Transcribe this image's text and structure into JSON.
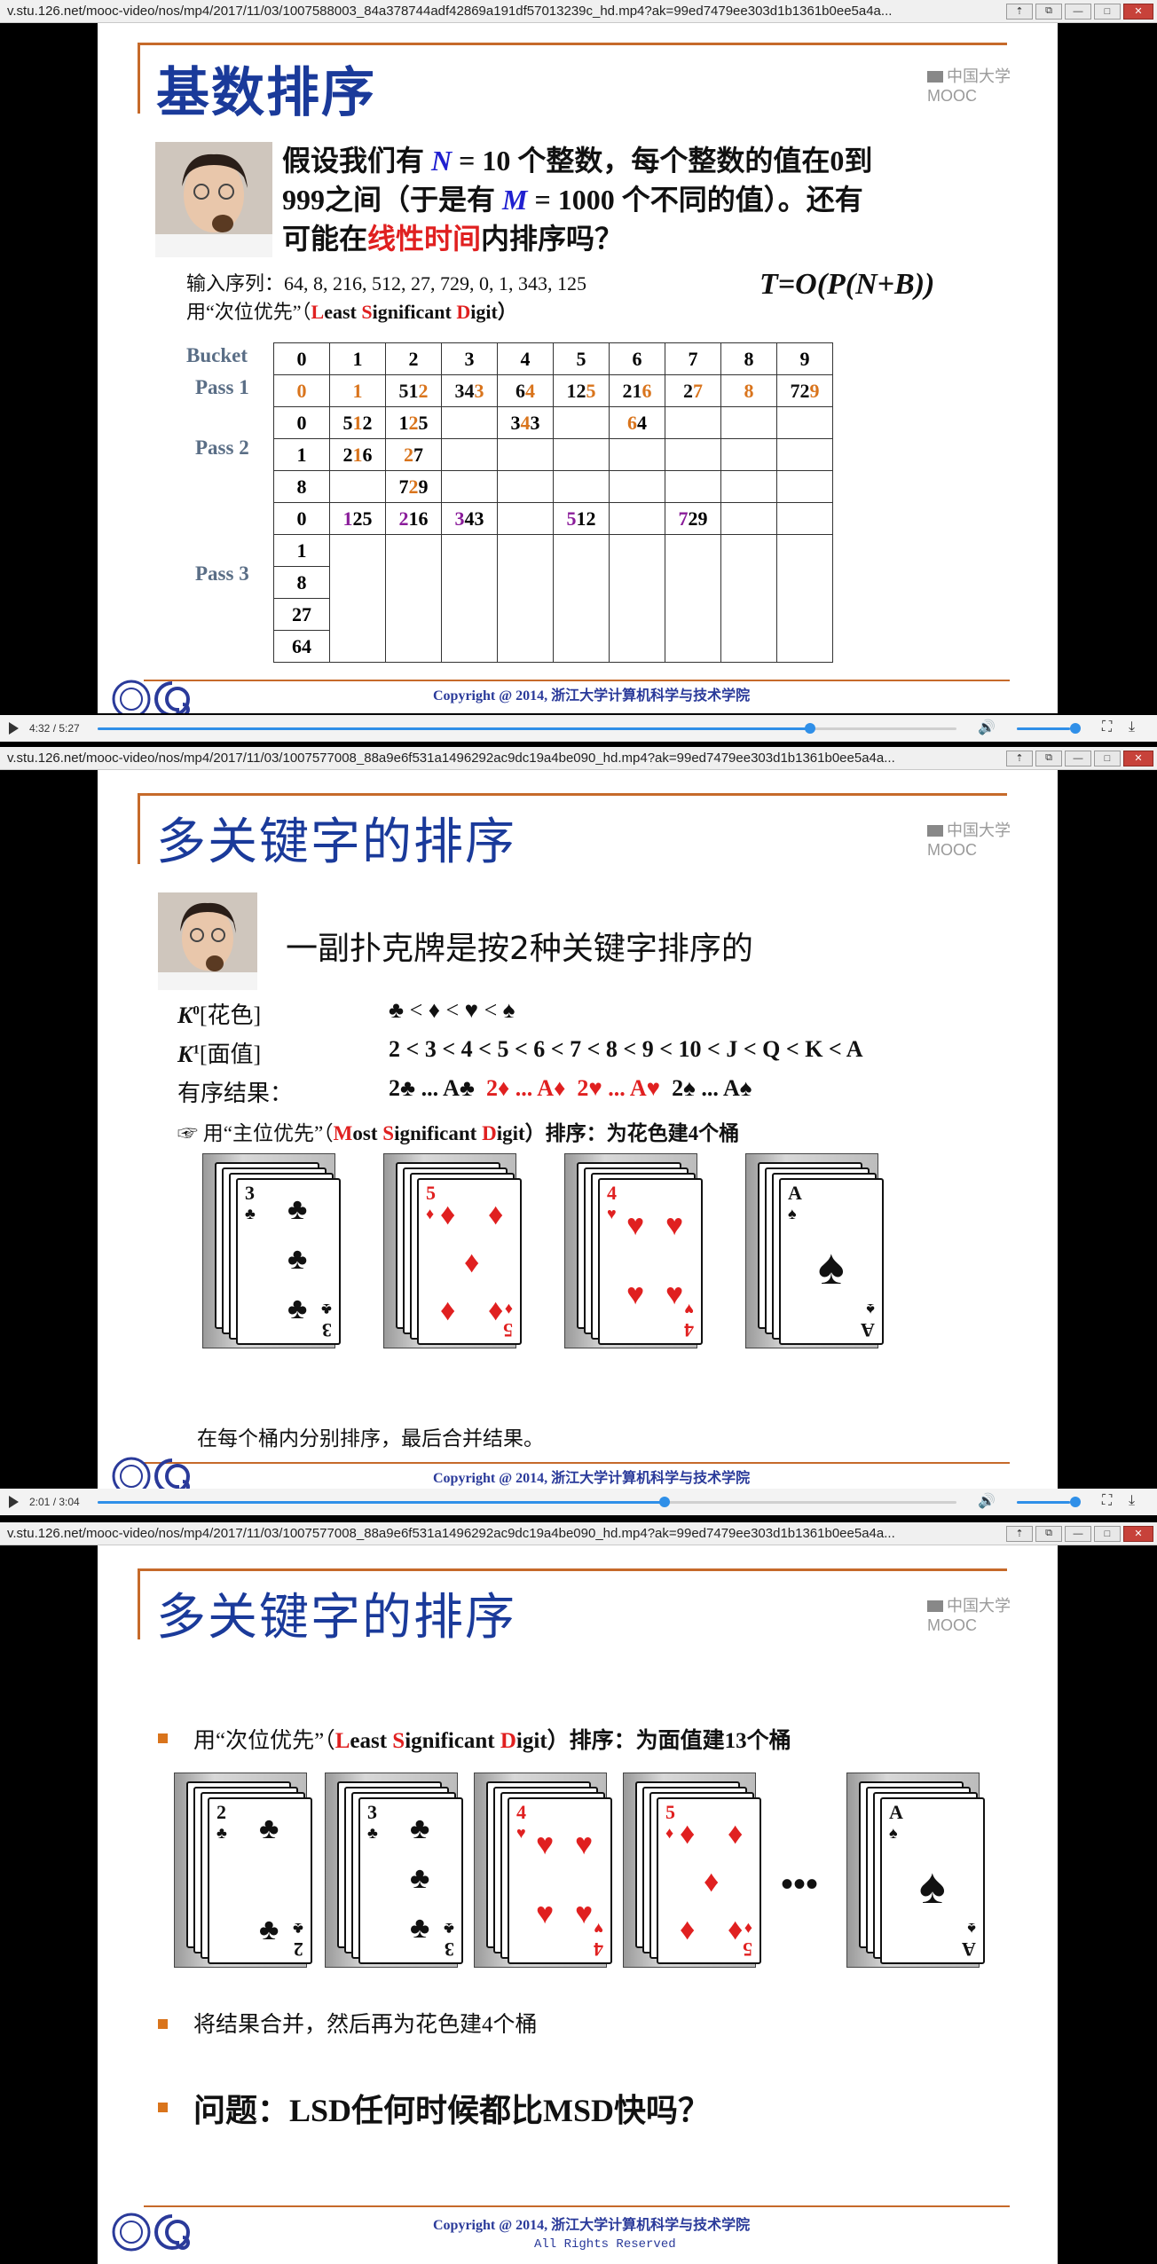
{
  "windows": [
    {
      "url": "v.stu.126.net/mooc-video/nos/mp4/2017/11/03/1007588003_84a378744adf42869a191df57013239c_hd.mp4?ak=99ed7479ee303d1b1361b0ee5a4a...",
      "time": "4:32 / 5:27",
      "progress": 0.83
    },
    {
      "url": "v.stu.126.net/mooc-video/nos/mp4/2017/11/03/1007577008_88a9e6f531a1496292ac9dc19a4be090_hd.mp4?ak=99ed7479ee303d1b1361b0ee5a4a...",
      "time": "2:01 / 3:04",
      "progress": 0.66
    },
    {
      "url": "v.stu.126.net/mooc-video/nos/mp4/2017/11/03/1007577008_88a9e6f531a1496292ac9dc19a4be090_hd.mp4?ak=99ed7479ee303d1b1361b0ee5a4a..."
    }
  ],
  "common": {
    "mooc": "中国大学MOOC",
    "copyright": "Copyright @ 2014, 浙江大学计算机科学与技术学院",
    "rights": "All Rights Reserved"
  },
  "slide1": {
    "title": "基数排序",
    "q1a": "假设我们有",
    "q1n": "N",
    "q1b": "= 10 个整数，每个整数的值在0到",
    "q2a": "999之间（于是有",
    "q2m": "M",
    "q2b": "= 1000 个不同的值）。还有",
    "q3a": "可能在",
    "q3red": "线性时间",
    "q3b": "内排序吗？",
    "input": "输入序列：64, 8, 216, 512, 27, 729, 0, 1, 343, 125",
    "lsd_a": "用“次位优先”（",
    "lsd_L": "L",
    "lsd_east": "east ",
    "lsd_S": "S",
    "lsd_ignificant": "ignificant ",
    "lsd_D": "D",
    "lsd_igit": "igit）",
    "formula": "T=O(P(N+B))",
    "labels": {
      "bucket": "Bucket",
      "pass1": "Pass 1",
      "pass2": "Pass 2",
      "pass3": "Pass 3"
    },
    "buckets": [
      "0",
      "1",
      "2",
      "3",
      "4",
      "5",
      "6",
      "7",
      "8",
      "9"
    ],
    "pass1": [
      "0",
      "1",
      "512",
      "343",
      "64",
      "125",
      "216",
      "27",
      "8",
      "729"
    ],
    "pass2": [
      [
        "0",
        "512",
        "125",
        "",
        "343",
        "",
        "64",
        "",
        "",
        ""
      ],
      [
        "1",
        "216",
        "27",
        "",
        "",
        "",
        "",
        "",
        "",
        ""
      ],
      [
        "8",
        "",
        "729",
        "",
        "",
        "",
        "",
        "",
        "",
        ""
      ]
    ],
    "pass3": [
      [
        "0",
        "125",
        "216",
        "343",
        "",
        "512",
        "",
        "729",
        "",
        ""
      ],
      [
        "1"
      ],
      [
        "8"
      ],
      [
        "27"
      ],
      [
        "64"
      ]
    ]
  },
  "slide2": {
    "title": "多关键字的排序",
    "intro": "一副扑克牌是按2种关键字排序的",
    "k0_label": "K",
    "k0_sup": "0",
    "k0_name": "[花色]",
    "k0_order": "♣  <  ♦  <  ♥  <  ♠",
    "k1_label": "K",
    "k1_sup": "1",
    "k1_name": "[面值]",
    "k1_order": "2 < 3 < 4 < 5 < 6 < 7 < 8 < 9 < 10 < J < Q < K < A",
    "result_label": "有序结果：",
    "r1": "2♣   ...   A♣",
    "r2": "2♦   ...  A♦",
    "r3": "2♥   ...  A♥",
    "r4": "2♠   ...  A♠",
    "msd_a": "用“主位优先”（",
    "msd_M": "M",
    "msd_ost": "ost ",
    "msd_S": "S",
    "msd_ignificant": "ignificant ",
    "msd_D": "D",
    "msd_igit": "igit）排序：为花色建4个桶",
    "footer": "在每个桶内分别排序，最后合并结果。",
    "cards": [
      {
        "rank": "3",
        "suit": "♣",
        "color": "#111"
      },
      {
        "rank": "5",
        "suit": "♦",
        "color": "#e02020"
      },
      {
        "rank": "4",
        "suit": "♥",
        "color": "#e02020"
      },
      {
        "rank": "A",
        "suit": "♠",
        "color": "#111"
      }
    ]
  },
  "slide3": {
    "title": "多关键字的排序",
    "b1_a": "用“次位优先”（",
    "b1_L": "L",
    "b1_east": "east ",
    "b1_S": "S",
    "b1_ignificant": "ignificant ",
    "b1_D": "D",
    "b1_igit": "igit）排序：为面值建13个桶",
    "dots": "•••",
    "b2": "将结果合并，然后再为花色建4个桶",
    "b3": "问题：LSD任何时候都比MSD快吗？",
    "cards": [
      {
        "rank": "2",
        "suit": "♣",
        "color": "#111"
      },
      {
        "rank": "3",
        "suit": "♣",
        "color": "#111"
      },
      {
        "rank": "4",
        "suit": "♥",
        "color": "#e02020"
      },
      {
        "rank": "5",
        "suit": "♦",
        "color": "#e02020"
      },
      {
        "rank": "A",
        "suit": "♠",
        "color": "#111"
      }
    ]
  }
}
